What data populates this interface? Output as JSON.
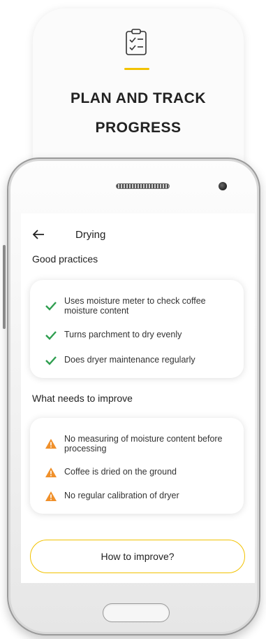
{
  "header": {
    "icon": "clipboard-checklist-icon",
    "title_line1": "PLAN AND TRACK",
    "title_line2": "PROGRESS"
  },
  "screen": {
    "back_icon": "back-arrow-icon",
    "title": "Drying",
    "good_practices": {
      "label": "Good practices",
      "items": [
        "Uses moisture meter to check coffee moisture content",
        "Turns parchment to dry evenly",
        "Does dryer maintenance regularly"
      ]
    },
    "improve": {
      "label": "What needs to improve",
      "items": [
        "No measuring of moisture content before processing",
        "Coffee is dried on the ground",
        "No regular calibration of dryer"
      ]
    },
    "button_label": "How to improve?"
  },
  "colors": {
    "accent_yellow": "#f2c200",
    "check_green": "#2e9e4f",
    "warning_orange": "#f0902a"
  }
}
